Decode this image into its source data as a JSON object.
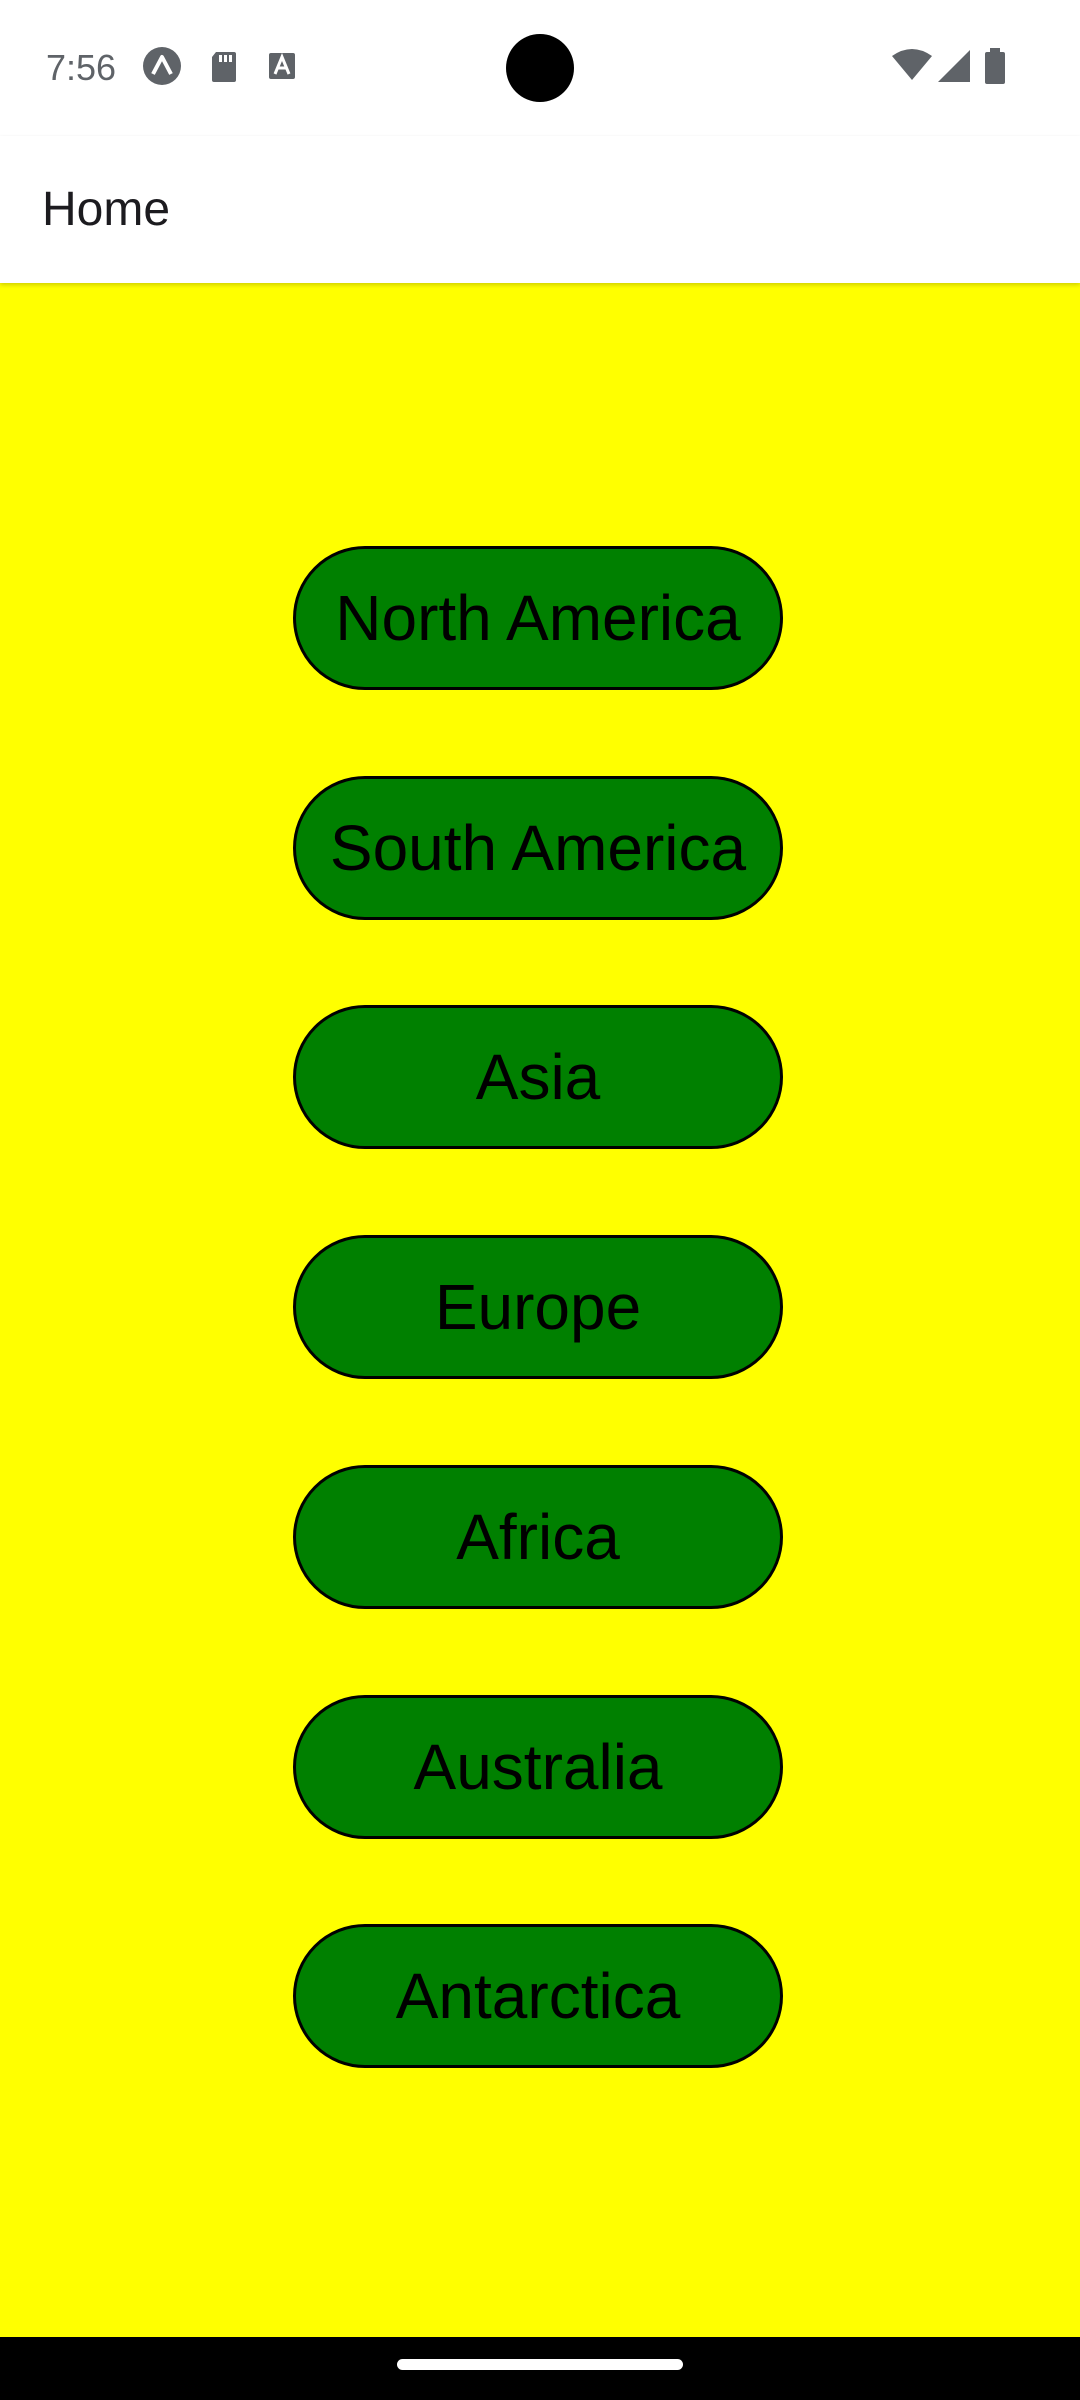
{
  "status_bar": {
    "time": "7:56",
    "icons": [
      "expo-icon",
      "sd-card-icon",
      "keyboard-a-icon",
      "wifi-icon",
      "signal-icon",
      "battery-icon"
    ]
  },
  "app_bar": {
    "title": "Home"
  },
  "colors": {
    "background": "#ffff00",
    "button_fill": "#008000",
    "button_border": "#000000",
    "button_text": "#000000"
  },
  "continents": [
    {
      "label": "North America"
    },
    {
      "label": "South America"
    },
    {
      "label": "Asia"
    },
    {
      "label": "Europe"
    },
    {
      "label": "Africa"
    },
    {
      "label": "Australia"
    },
    {
      "label": "Antarctica"
    }
  ]
}
